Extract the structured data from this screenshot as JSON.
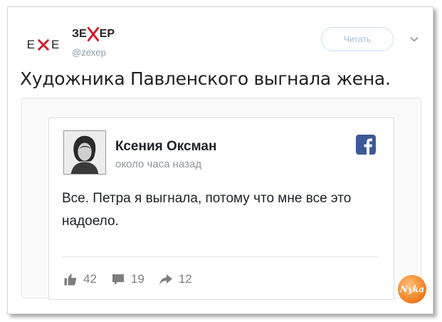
{
  "account": {
    "avatar_left": "E",
    "avatar_right": "E",
    "name_part1": "ЗЕ",
    "name_part2": "ЕР",
    "handle": "@zexep"
  },
  "follow_label": "Читать",
  "tweet_text": "Художника Павленского выгнала жена.",
  "fb_post": {
    "author": "Ксения Оксман",
    "time": "около часа назад",
    "body": "Все. Петра я выгнала, потому что мне все это надоело.",
    "likes": "42",
    "comments": "19",
    "shares": "12"
  },
  "stamp_text": "Nyka",
  "colors": {
    "accent_red": "#d0202a",
    "follow_text": "#9bbfe2",
    "facebook_blue": "#3b5998",
    "stamp_orange": "#f07a1a"
  }
}
